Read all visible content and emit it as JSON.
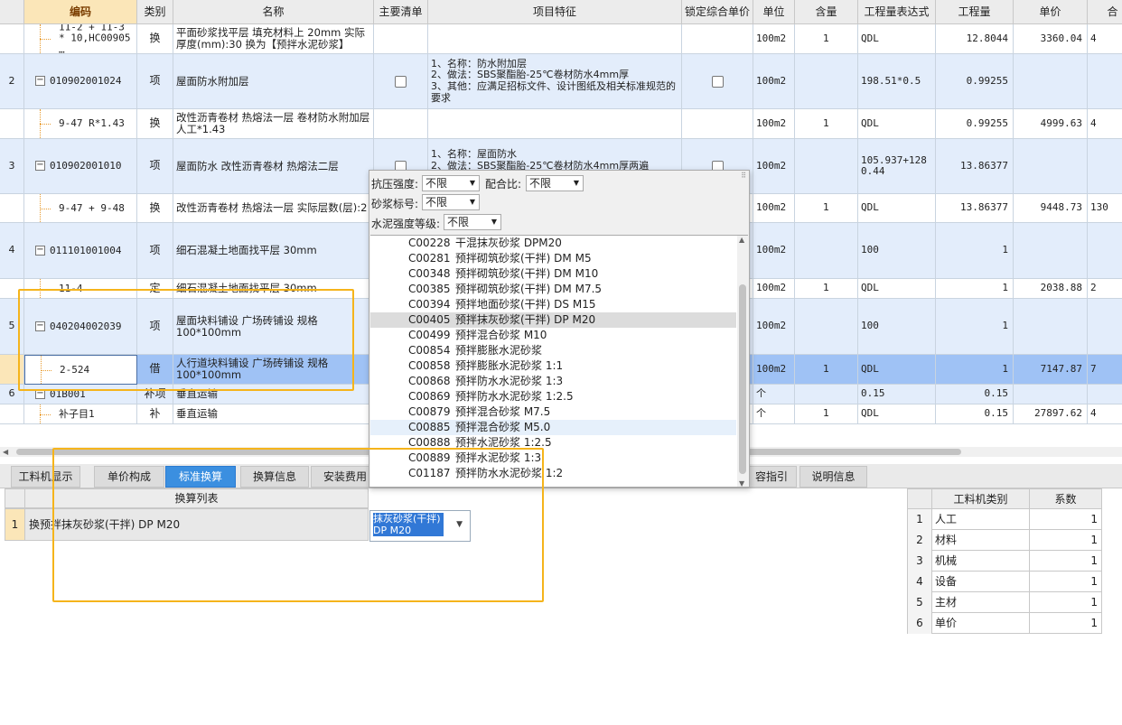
{
  "columns": [
    {
      "key": "seq",
      "label": ""
    },
    {
      "key": "code",
      "label": "编码"
    },
    {
      "key": "type",
      "label": "类别"
    },
    {
      "key": "name",
      "label": "名称"
    },
    {
      "key": "main",
      "label": "主要清单"
    },
    {
      "key": "feature",
      "label": "项目特征"
    },
    {
      "key": "lock",
      "label": "锁定综合单价"
    },
    {
      "key": "unit",
      "label": "单位"
    },
    {
      "key": "qty",
      "label": "含量"
    },
    {
      "key": "expr",
      "label": "工程量表达式"
    },
    {
      "key": "amount",
      "label": "工程量"
    },
    {
      "key": "price",
      "label": "单价"
    },
    {
      "key": "total",
      "label": "合"
    }
  ],
  "rows": [
    {
      "seq": "",
      "code": "11-2 + 11-3 * 10,HC00905 …",
      "type": "换",
      "name": "平面砂浆找平层 填充材料上 20mm  实际厚度(mm):30  换为【预拌水泥砂浆】",
      "feature": "",
      "unit": "100m2",
      "qty": "1",
      "expr": "QDL",
      "amount": "12.8044",
      "price": "3360.04",
      "total": "4"
    },
    {
      "seq": "2",
      "code": "010902001024",
      "type": "项",
      "name": "屋面防水附加层",
      "feature": "1、名称：防水附加层\n2、做法：SBS聚酯胎-25℃卷材防水4mm厚\n3、其他：应满足招标文件、设计图纸及相关标准规范的要求",
      "unit": "100m2",
      "qty": "",
      "expr": "198.51*0.5",
      "amount": "0.99255",
      "price": "",
      "total": ""
    },
    {
      "seq": "",
      "code": "9-47 R*1.43",
      "type": "换",
      "name": "改性沥青卷材 热熔法一层  卷材防水附加层 人工*1.43",
      "feature": "",
      "unit": "100m2",
      "qty": "1",
      "expr": "QDL",
      "amount": "0.99255",
      "price": "4999.63",
      "total": "4"
    },
    {
      "seq": "3",
      "code": "010902001010",
      "type": "项",
      "name": "屋面防水 改性沥青卷材 热熔法二层",
      "feature": "1、名称：屋面防水\n2、做法：SBS聚酯胎-25℃卷材防水4mm厚两遍\n3、其他：应满足招标文件、设计图纸及相关标准规",
      "unit": "100m2",
      "qty": "",
      "expr": "105.937+1280.44",
      "amount": "13.86377",
      "price": "",
      "total": ""
    },
    {
      "seq": "",
      "code": "9-47 + 9-48",
      "type": "换",
      "name": "改性沥青卷材 热熔法一层  实际层数(层):2",
      "feature": "",
      "unit": "100m2",
      "qty": "1",
      "expr": "QDL",
      "amount": "13.86377",
      "price": "9448.73",
      "total": "130"
    },
    {
      "seq": "4",
      "code": "011101001004",
      "type": "项",
      "name": "细石混凝土地面找平层 30mm",
      "feature": "",
      "unit": "100m2",
      "qty": "",
      "expr": "100",
      "amount": "1",
      "price": "",
      "total": ""
    },
    {
      "seq": "",
      "code": "11-4",
      "type": "定",
      "name": "细石混凝土地面找平层 30mm",
      "feature": "",
      "unit": "100m2",
      "qty": "1",
      "expr": "QDL",
      "amount": "1",
      "price": "2038.88",
      "total": "2"
    },
    {
      "seq": "5",
      "code": "040204002039",
      "type": "项",
      "name": "屋面块料铺设 广场砖铺设 规格100*100mm",
      "feature": "",
      "unit": "100m2",
      "qty": "",
      "expr": "100",
      "amount": "1",
      "price": "",
      "total": ""
    },
    {
      "seq": "",
      "code": "2-524",
      "type": "借",
      "name": "人行道块料铺设 广场砖铺设 规格100*100mm",
      "feature": "",
      "unit": "100m2",
      "qty": "1",
      "expr": "QDL",
      "amount": "1",
      "price": "7147.87",
      "total": "7"
    },
    {
      "seq": "6",
      "code": "01B001",
      "type": "补项",
      "name": "垂直运输",
      "feature": "",
      "unit": "个",
      "qty": "",
      "expr": "0.15",
      "amount": "0.15",
      "price": "",
      "total": ""
    },
    {
      "seq": "",
      "code": "补子目1",
      "type": "补",
      "name": "垂直运输",
      "feature": "",
      "unit": "个",
      "qty": "1",
      "expr": "QDL",
      "amount": "0.15",
      "price": "27897.62",
      "total": "4"
    }
  ],
  "tabs": [
    "工料机显示",
    "单价构成",
    "标准换算",
    "换算信息",
    "安装费用",
    "容指引",
    "说明信息"
  ],
  "active_tab": "标准换算",
  "conversion": {
    "header": "换算列表",
    "rows": [
      {
        "num": "1",
        "label": "换预拌抹灰砂浆(干拌) DP M20",
        "value": "抹灰砂浆(干拌) DP M20"
      }
    ]
  },
  "category_table": {
    "headers": [
      "工料机类别",
      "系数"
    ],
    "rows": [
      {
        "num": "1",
        "name": "人工",
        "coef": "1"
      },
      {
        "num": "2",
        "name": "材料",
        "coef": "1"
      },
      {
        "num": "3",
        "name": "机械",
        "coef": "1"
      },
      {
        "num": "4",
        "name": "设备",
        "coef": "1"
      },
      {
        "num": "5",
        "name": "主材",
        "coef": "1"
      },
      {
        "num": "6",
        "name": "单价",
        "coef": "1"
      }
    ]
  },
  "popup": {
    "filters": {
      "strength_label": "抗压强度:",
      "strength_value": "不限",
      "mix_label": "配合比:",
      "mix_value": "不限",
      "grade_label": "砂浆标号:",
      "grade_value": "不限",
      "cement_label": "水泥强度等级:",
      "cement_value": "不限"
    },
    "items": [
      {
        "code": "C00228",
        "name": "干混抹灰砂浆 DPM20"
      },
      {
        "code": "C00281",
        "name": "预拌砌筑砂浆(干拌) DM M5"
      },
      {
        "code": "C00348",
        "name": "预拌砌筑砂浆(干拌) DM M10"
      },
      {
        "code": "C00385",
        "name": "预拌砌筑砂浆(干拌) DM M7.5"
      },
      {
        "code": "C00394",
        "name": "预拌地面砂浆(干拌) DS M15"
      },
      {
        "code": "C00405",
        "name": "预拌抹灰砂浆(干拌) DP M20"
      },
      {
        "code": "C00499",
        "name": "预拌混合砂浆 M10"
      },
      {
        "code": "C00854",
        "name": "预拌膨胀水泥砂浆"
      },
      {
        "code": "C00858",
        "name": "预拌膨胀水泥砂浆 1:1"
      },
      {
        "code": "C00868",
        "name": "预拌防水水泥砂浆 1:3"
      },
      {
        "code": "C00869",
        "name": "预拌防水水泥砂浆 1:2.5"
      },
      {
        "code": "C00879",
        "name": "预拌混合砂浆 M7.5"
      },
      {
        "code": "C00885",
        "name": "预拌混合砂浆 M5.0"
      },
      {
        "code": "C00888",
        "name": "预拌水泥砂浆 1:2.5"
      },
      {
        "code": "C00889",
        "name": "预拌水泥砂浆 1:3"
      },
      {
        "code": "C01187",
        "name": "预拌防水水泥砂浆 1:2"
      }
    ]
  }
}
